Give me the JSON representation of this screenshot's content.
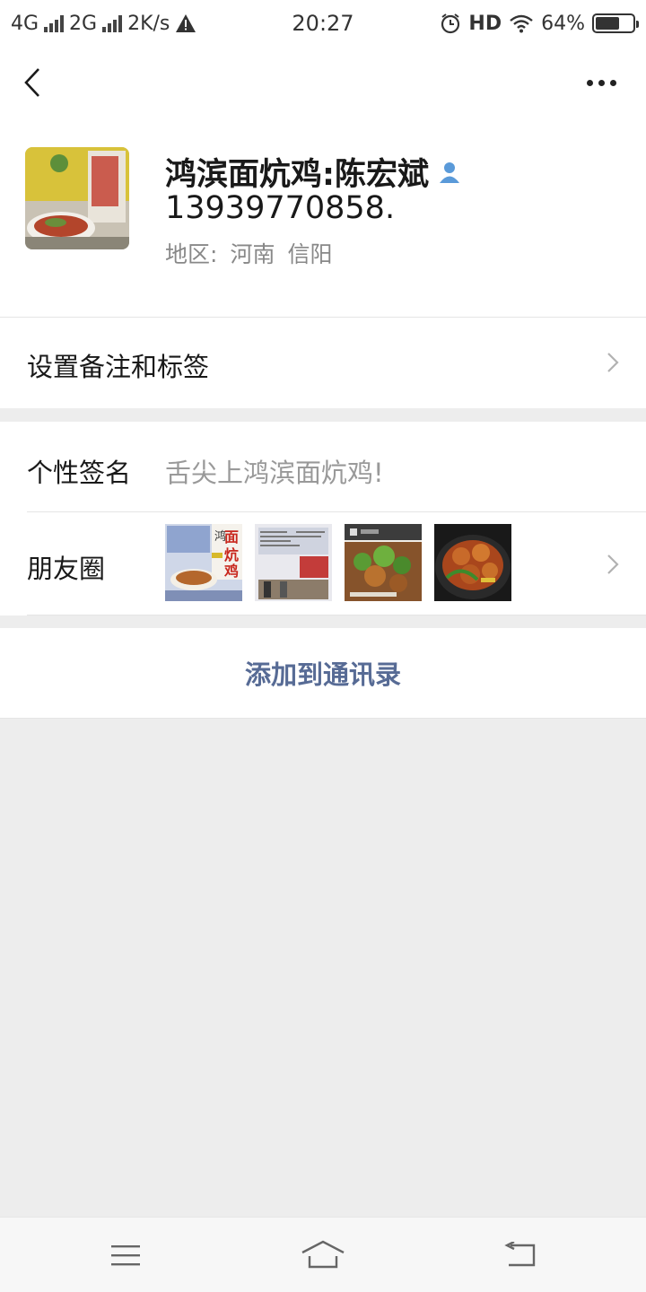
{
  "status_bar": {
    "network1": "4G",
    "network2": "2G",
    "speed": "2K/s",
    "time": "20:27",
    "hd": "HD",
    "battery": "64%",
    "battery_level": 0.64
  },
  "profile": {
    "name_line1": "鸿滨面炕鸡:陈宏斌",
    "name_line2": "13939770858.",
    "region_label": "地区:",
    "region_province": "河南",
    "region_city": "信阳"
  },
  "rows": {
    "remark_label": "设置备注和标签",
    "signature_label": "个性签名",
    "signature_value": "舌尖上鸿滨面炕鸡!",
    "moments_label": "朋友圈",
    "moment_thumb1_text": "面炕鸡",
    "moment_thumb1_small": "鸿"
  },
  "actions": {
    "add_contact": "添加到通讯录"
  },
  "colors": {
    "link": "#576b95",
    "background": "#ededed"
  }
}
